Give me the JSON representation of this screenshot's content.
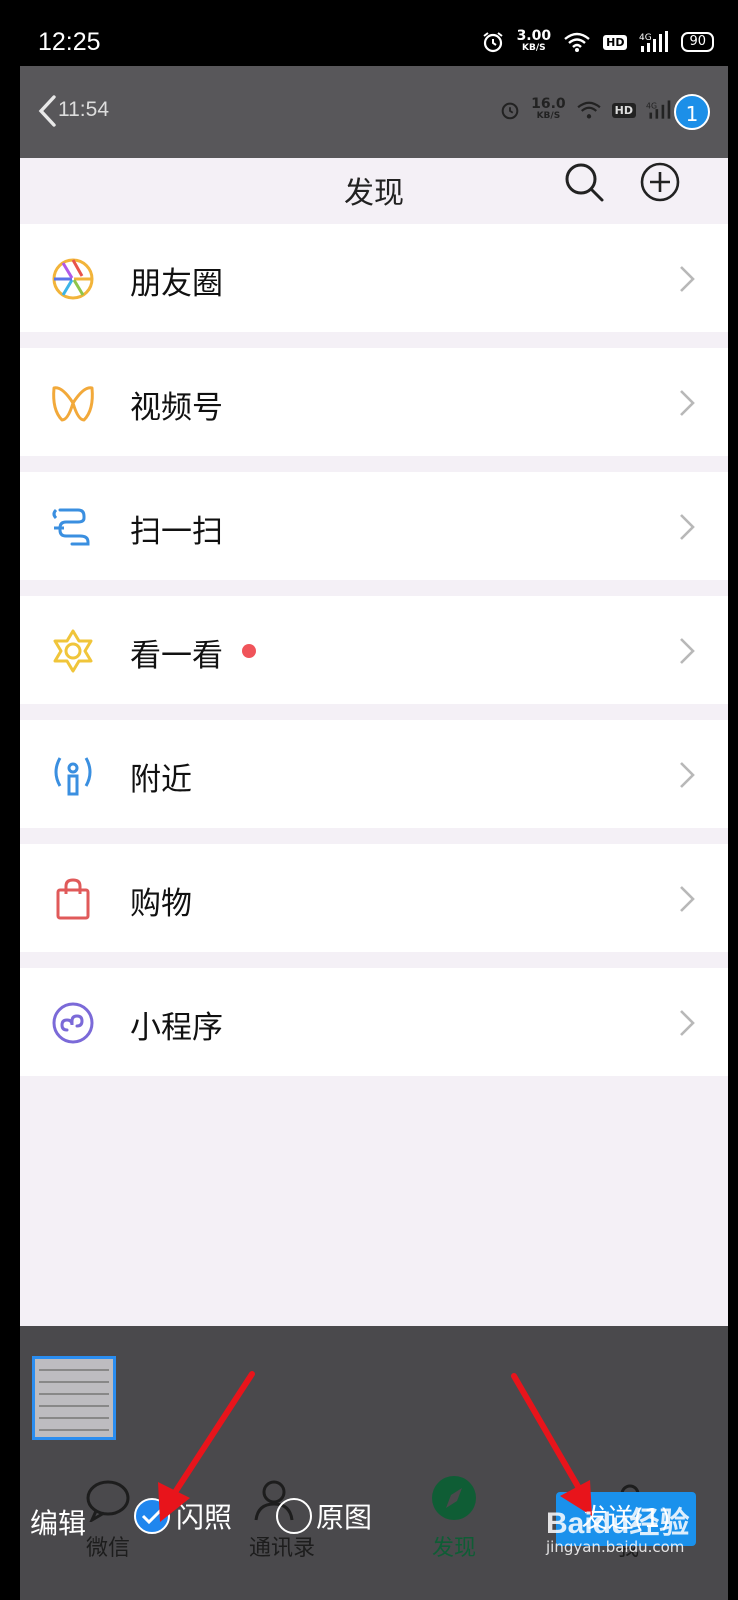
{
  "status_bar": {
    "time": "12:25",
    "speed": "3.00",
    "speed_unit": "KB/S",
    "hd": "HD",
    "network": "4G",
    "battery": "90"
  },
  "inner_status_bar": {
    "time": "11:54",
    "speed": "16.0",
    "speed_unit": "KB/S",
    "hd": "HD",
    "network": "4G",
    "selected_count": "1"
  },
  "header": {
    "title": "发现"
  },
  "menu": [
    {
      "label": "朋友圈",
      "icon": "moments-aperture-icon",
      "has_dot": false
    },
    {
      "label": "视频号",
      "icon": "channels-icon",
      "has_dot": false
    },
    {
      "label": "扫一扫",
      "icon": "scan-icon",
      "has_dot": false
    },
    {
      "label": "看一看",
      "icon": "top-stories-icon",
      "has_dot": true
    },
    {
      "label": "附近",
      "icon": "nearby-icon",
      "has_dot": false
    },
    {
      "label": "购物",
      "icon": "shopping-bag-icon",
      "has_dot": false
    },
    {
      "label": "小程序",
      "icon": "mini-program-icon",
      "has_dot": false
    }
  ],
  "picker": {
    "edit_label": "编辑",
    "flash_label": "闪照",
    "flash_checked": true,
    "original_label": "原图",
    "original_checked": false,
    "send_label": "发送(1)"
  },
  "tabs": [
    {
      "label": "微信",
      "icon": "chat-bubble-icon"
    },
    {
      "label": "通讯录",
      "icon": "contacts-icon"
    },
    {
      "label": "发现",
      "icon": "discover-compass-icon",
      "active": true
    },
    {
      "label": "我",
      "icon": "me-icon"
    }
  ],
  "watermark": {
    "logo": "Baidu经验",
    "url": "jingyan.baidu.com"
  },
  "colors": {
    "accent": "#1a91ec",
    "annotation_arrow": "#e8141b",
    "menu_dot": "#f0545a",
    "active_tab": "#0f5d35"
  }
}
